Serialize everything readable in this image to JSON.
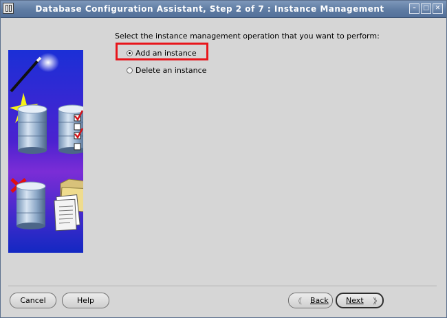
{
  "window": {
    "title": "Database Configuration Assistant, Step 2 of 7 : Instance Management",
    "controls": {
      "minimize": "–",
      "maximize": "□",
      "close": "✕"
    }
  },
  "illustration": {
    "icons": [
      "magic-wand-icon",
      "sparkle-icon",
      "database-icon",
      "checklist-icon",
      "delete-x-icon",
      "folder-documents-icon"
    ]
  },
  "main": {
    "prompt": "Select the instance management operation that you want to perform:",
    "options": [
      {
        "label": "Add an instance",
        "selected": true
      },
      {
        "label": "Delete an instance",
        "selected": false
      }
    ],
    "highlight_color": "#e8151b"
  },
  "footer": {
    "cancel_label": "Cancel",
    "help_label": "Help",
    "back_label": "Back",
    "next_label": "Next",
    "back_chevron": "《",
    "next_chevron": "》"
  }
}
